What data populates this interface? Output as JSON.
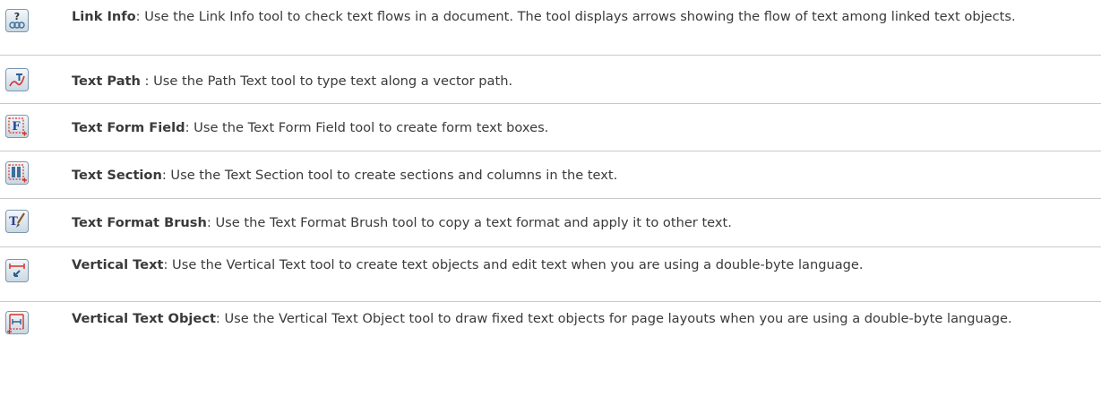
{
  "tools": [
    {
      "name": "Link Info",
      "separator": ":",
      "description": " Use the Link Info tool to check text flows in a document. The tool displays arrows showing the flow of text among linked text objects.",
      "icon": "link-info-icon"
    },
    {
      "name": "Text Path",
      "separator": " :",
      "description": " Use the Path Text tool to type text along a vector path.",
      "icon": "text-path-icon"
    },
    {
      "name": "Text Form Field",
      "separator": ":",
      "description": " Use the Text Form Field tool to create form text boxes.",
      "icon": "text-form-field-icon"
    },
    {
      "name": "Text Section",
      "separator": ":",
      "description": " Use the Text Section tool to create sections and columns in the text.",
      "icon": "text-section-icon"
    },
    {
      "name": "Text Format Brush",
      "separator": ":",
      "description": " Use the Text Format Brush tool to copy a text format and apply it to other text.",
      "icon": "text-format-brush-icon"
    },
    {
      "name": "Vertical Text",
      "separator": ":",
      "description": " Use the Vertical Text tool to create text objects and edit text when you are using a double-byte language.",
      "icon": "vertical-text-icon"
    },
    {
      "name": "Vertical Text Object",
      "separator": ":",
      "description": " Use the Vertical Text Object tool to draw fixed text objects for page layouts when you are using a double-byte language.",
      "icon": "vertical-text-object-icon"
    }
  ]
}
